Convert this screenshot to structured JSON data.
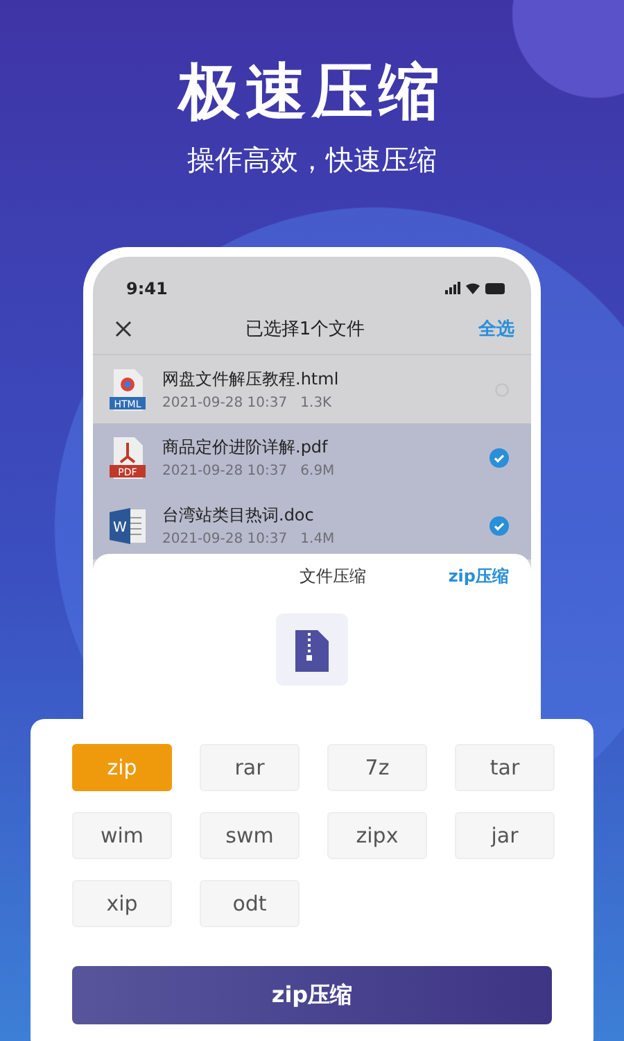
{
  "headline": "极速压缩",
  "subheadline": "操作高效，快速压缩",
  "phone": {
    "status_time": "9:41",
    "header": {
      "title": "已选择1个文件",
      "action": "全选"
    },
    "files": [
      {
        "kind": "html",
        "badge": "HTML",
        "name": "网盘文件解压教程.html",
        "meta": "2021-09-28 10:37   1.3K",
        "selected": false
      },
      {
        "kind": "pdf",
        "badge": "PDF",
        "name": "商品定价进阶详解.pdf",
        "meta": "2021-09-28 10:37   6.9M",
        "selected": true
      },
      {
        "kind": "doc",
        "badge": "W",
        "name": "台湾站类目热词.doc",
        "meta": "2021-09-28 10:37   1.4M",
        "selected": true
      }
    ],
    "sheet": {
      "title": "文件压缩",
      "action": "zip压缩"
    }
  },
  "formats": [
    {
      "label": "zip",
      "selected": true
    },
    {
      "label": "rar",
      "selected": false
    },
    {
      "label": "7z",
      "selected": false
    },
    {
      "label": "tar",
      "selected": false
    },
    {
      "label": "wim",
      "selected": false
    },
    {
      "label": "swm",
      "selected": false
    },
    {
      "label": "zipx",
      "selected": false
    },
    {
      "label": "jar",
      "selected": false
    },
    {
      "label": "xip",
      "selected": false
    },
    {
      "label": "odt",
      "selected": false
    }
  ],
  "compress_button": "zip压缩"
}
